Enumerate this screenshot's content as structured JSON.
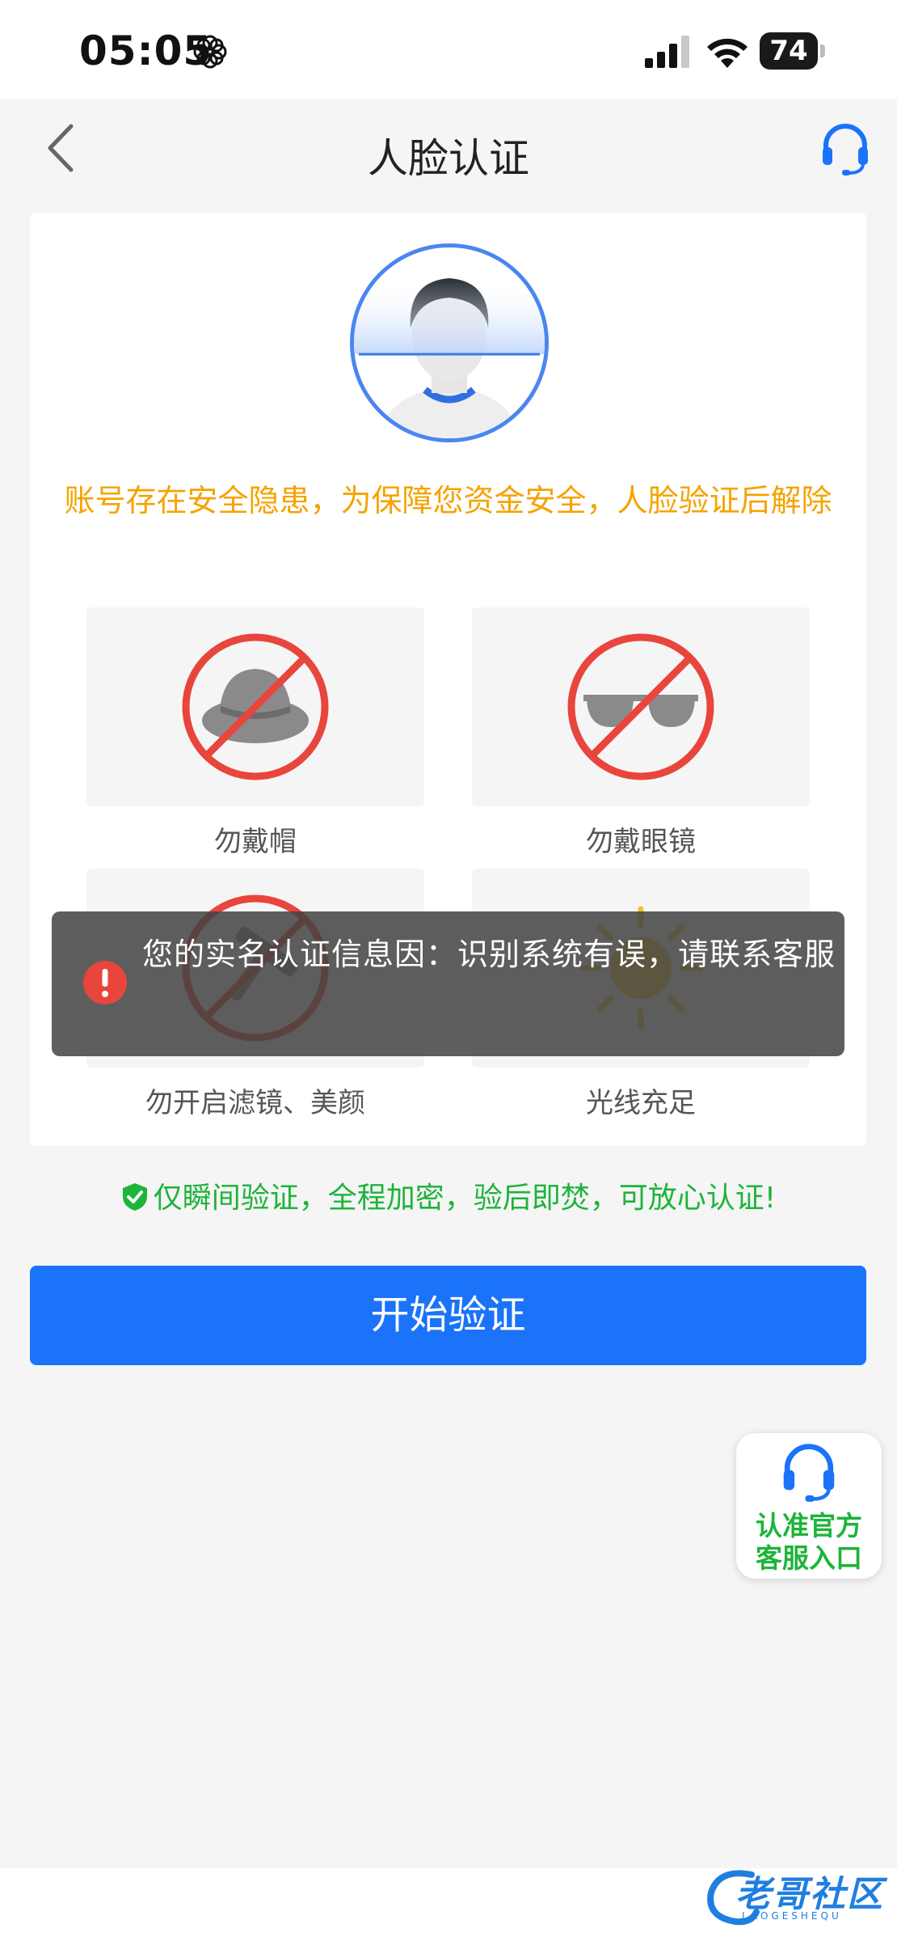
{
  "status_bar": {
    "time": "05:05",
    "battery": "74"
  },
  "nav": {
    "title": "人脸认证",
    "back_icon": "chevron-left-icon",
    "support_icon": "headset-icon"
  },
  "card": {
    "warning": "账号存在安全隐患，为保障您资金安全，人脸验证后解除",
    "tips": [
      {
        "label": "勿戴帽",
        "icon": "no-hat-icon"
      },
      {
        "label": "勿戴眼镜",
        "icon": "no-glasses-icon"
      },
      {
        "label": "勿开启滤镜、美颜",
        "icon": "no-filter-icon"
      },
      {
        "label": "光线充足",
        "icon": "sun-icon"
      }
    ]
  },
  "secure_note": "仅瞬间验证，全程加密，验后即焚，可放心认证!",
  "start_button": "开始验证",
  "toast": {
    "message": "您的实名认证信息因：识别系统有误，请联系客服"
  },
  "floating_support": {
    "line1": "认准官方",
    "line2": "客服入口"
  },
  "watermark": {
    "text": "老哥社区",
    "sub": "LAOGESHEQU"
  },
  "colors": {
    "primary": "#1a73f8",
    "warning": "#f5a300",
    "success": "#1db43a",
    "forbid": "#e8453c"
  }
}
